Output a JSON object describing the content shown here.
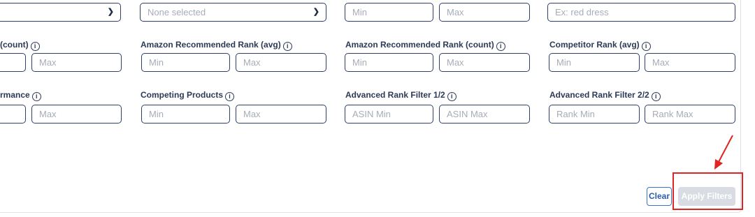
{
  "colors": {
    "accent": "#2a5db0",
    "field_border": "#2f3f6b",
    "annotation": "#e02424",
    "disabled_button": "#d9dde3"
  },
  "row1": {
    "select_a": {
      "value": "",
      "icon": "chevron-down-icon"
    },
    "select_b": {
      "placeholder": "None selected",
      "icon": "chevron-down-icon"
    },
    "range_min": "Min",
    "range_max": "Max",
    "keyword_placeholder": "Ex: red dress"
  },
  "row2": {
    "col0": {
      "label": "(count)",
      "max": "Max"
    },
    "col1": {
      "label": "Amazon Recommended Rank (avg)",
      "min": "Min",
      "max": "Max"
    },
    "col2": {
      "label": "Amazon Recommended Rank (count)",
      "min": "Min",
      "max": "Max"
    },
    "col3": {
      "label": "Competitor Rank (avg)",
      "min": "Min",
      "max": "Max"
    }
  },
  "row3": {
    "col0": {
      "label": "rmance",
      "max": "Max"
    },
    "col1": {
      "label": "Competing Products",
      "min": "Min",
      "max": "Max"
    },
    "col2": {
      "label": "Advanced Rank Filter 1/2",
      "min": "ASIN Min",
      "max": "ASIN Max"
    },
    "col3": {
      "label": "Advanced Rank Filter 2/2",
      "min": "Rank Min",
      "max": "Rank Max"
    }
  },
  "info_glyph": "i",
  "buttons": {
    "clear": "Clear",
    "apply": "Apply Filters"
  }
}
